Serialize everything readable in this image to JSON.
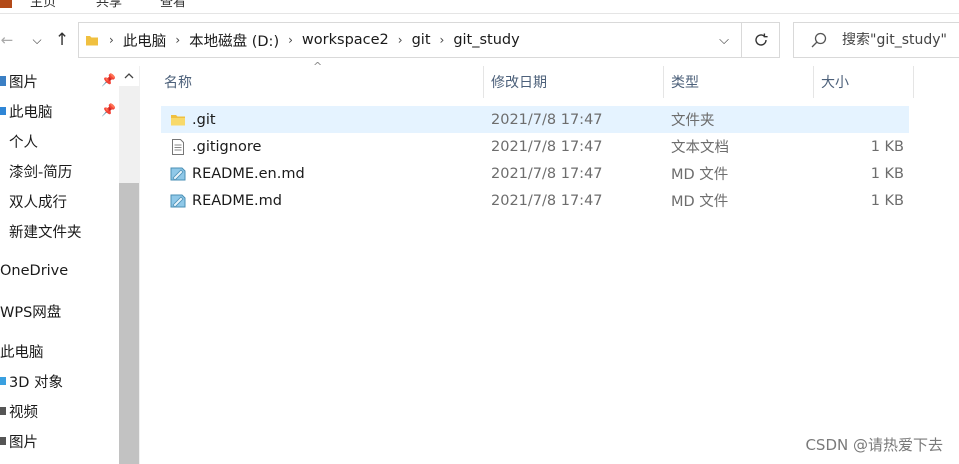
{
  "ribbon": {
    "tabs": [
      "主页",
      "共享",
      "查看"
    ]
  },
  "nav": {
    "back": "←",
    "dropdown": "⌵",
    "up": "↑"
  },
  "address": {
    "crumbs": [
      "此电脑",
      "本地磁盘 (D:)",
      "workspace2",
      "git",
      "git_study"
    ],
    "separator": "›"
  },
  "search": {
    "placeholder": "搜索\"git_study\""
  },
  "sidebar": {
    "items": [
      {
        "label": "图片",
        "pinned": true,
        "icon": "pictures-icon"
      },
      {
        "label": "此电脑",
        "pinned": true,
        "icon": "computer-icon"
      },
      {
        "label": "个人",
        "pinned": false,
        "icon": "folder-icon"
      },
      {
        "label": "漆剑-简历",
        "pinned": false,
        "icon": "folder-icon"
      },
      {
        "label": "双人成行",
        "pinned": false,
        "icon": "folder-icon"
      },
      {
        "label": "新建文件夹",
        "pinned": false,
        "icon": "folder-icon"
      },
      {
        "label": "OneDrive",
        "pinned": false,
        "icon": "onedrive-icon"
      },
      {
        "label": "WPS网盘",
        "pinned": false,
        "icon": "wps-icon"
      },
      {
        "label": "此电脑",
        "pinned": false,
        "icon": "computer-icon"
      },
      {
        "label": "3D 对象",
        "pinned": false,
        "icon": "3d-objects-icon"
      },
      {
        "label": "视频",
        "pinned": false,
        "icon": "videos-icon"
      },
      {
        "label": "图片",
        "pinned": false,
        "icon": "pictures-icon"
      }
    ]
  },
  "columns": {
    "name": "名称",
    "date": "修改日期",
    "type": "类型",
    "size": "大小"
  },
  "files": [
    {
      "name": ".git",
      "date": "2021/7/8 17:47",
      "type": "文件夹",
      "size": "",
      "icon": "folder-icon",
      "selected": true
    },
    {
      "name": ".gitignore",
      "date": "2021/7/8 17:47",
      "type": "文本文档",
      "size": "1 KB",
      "icon": "text-file-icon",
      "selected": false
    },
    {
      "name": "README.en.md",
      "date": "2021/7/8 17:47",
      "type": "MD 文件",
      "size": "1 KB",
      "icon": "md-file-icon",
      "selected": false
    },
    {
      "name": "README.md",
      "date": "2021/7/8 17:47",
      "type": "MD 文件",
      "size": "1 KB",
      "icon": "md-file-icon",
      "selected": false
    }
  ],
  "watermark": "CSDN @请热爱下去",
  "colors": {
    "selection": "#e5f3ff",
    "header_text": "#4c607a",
    "folder": "#f0c040",
    "accent_blue": "#0a64c8"
  }
}
